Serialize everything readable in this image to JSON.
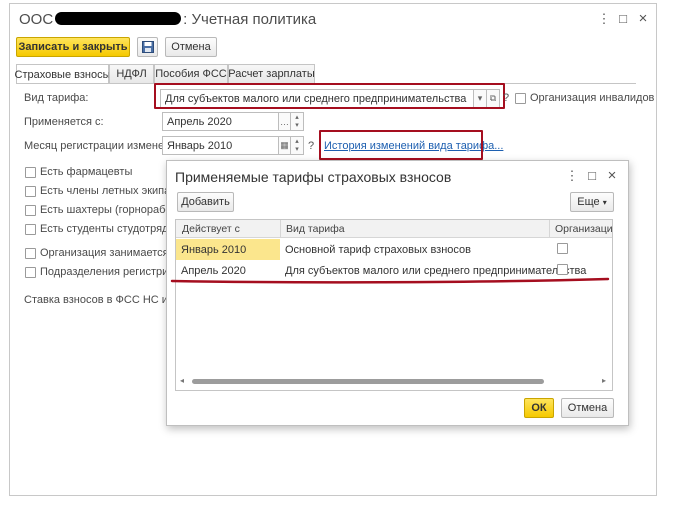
{
  "window": {
    "title_prefix": "ООС",
    "title_suffix": ": Учетная политика",
    "more_icon": "⋮",
    "maximize_icon": "□",
    "close_icon": "×"
  },
  "toolbar": {
    "save_close_label": "Записать и закрыть",
    "save_icon": "floppy-disk-icon",
    "cancel_label": "Отмена"
  },
  "tabs": [
    {
      "label": "Страховые взносы",
      "active": true
    },
    {
      "label": "НДФЛ",
      "active": false
    },
    {
      "label": "Пособия ФСС",
      "active": false
    },
    {
      "label": "Расчет зарплаты",
      "active": false
    }
  ],
  "form": {
    "tariff_label": "Вид тарифа:",
    "tariff_value": "Для субъектов малого или среднего предпринимательства",
    "help_mark": "?",
    "disabled_org_label": "Организация инвалидов",
    "applied_from_label": "Применяется с:",
    "applied_from_value": "Апрель 2020",
    "reg_month_label": "Месяц регистрации изменений:",
    "reg_month_value": "Январь 2010",
    "history_link": "История изменений вида тарифа...",
    "checkboxes": [
      "Есть фармацевты",
      "Есть члены летных экипажей",
      "Есть шахтеры (горнорабочие)",
      "Есть студенты студотрядов",
      "Организация занимается раст",
      "Подразделения регистрируют"
    ],
    "fss_rate_label": "Ставка взносов в ФСС НС и ПЗ:"
  },
  "dialog": {
    "title": "Применяемые тарифы страховых взносов",
    "add_label": "Добавить",
    "more_label": "Еще",
    "columns": [
      "Действует с",
      "Вид тарифа",
      "Организация"
    ],
    "rows": [
      {
        "date": "Январь 2010",
        "tariff": "Основной тариф страховых взносов",
        "checked": false,
        "selected": true
      },
      {
        "date": "Апрель 2020",
        "tariff": "Для субъектов малого или среднего предпринимательства",
        "checked": false,
        "selected": false
      }
    ],
    "ok_label": "ОК",
    "cancel_label": "Отмена"
  },
  "colors": {
    "accent_yellow": "#f5c900",
    "highlight_red": "#a50e1f",
    "link_blue": "#1d5fb0",
    "selection": "#fbe68d"
  }
}
